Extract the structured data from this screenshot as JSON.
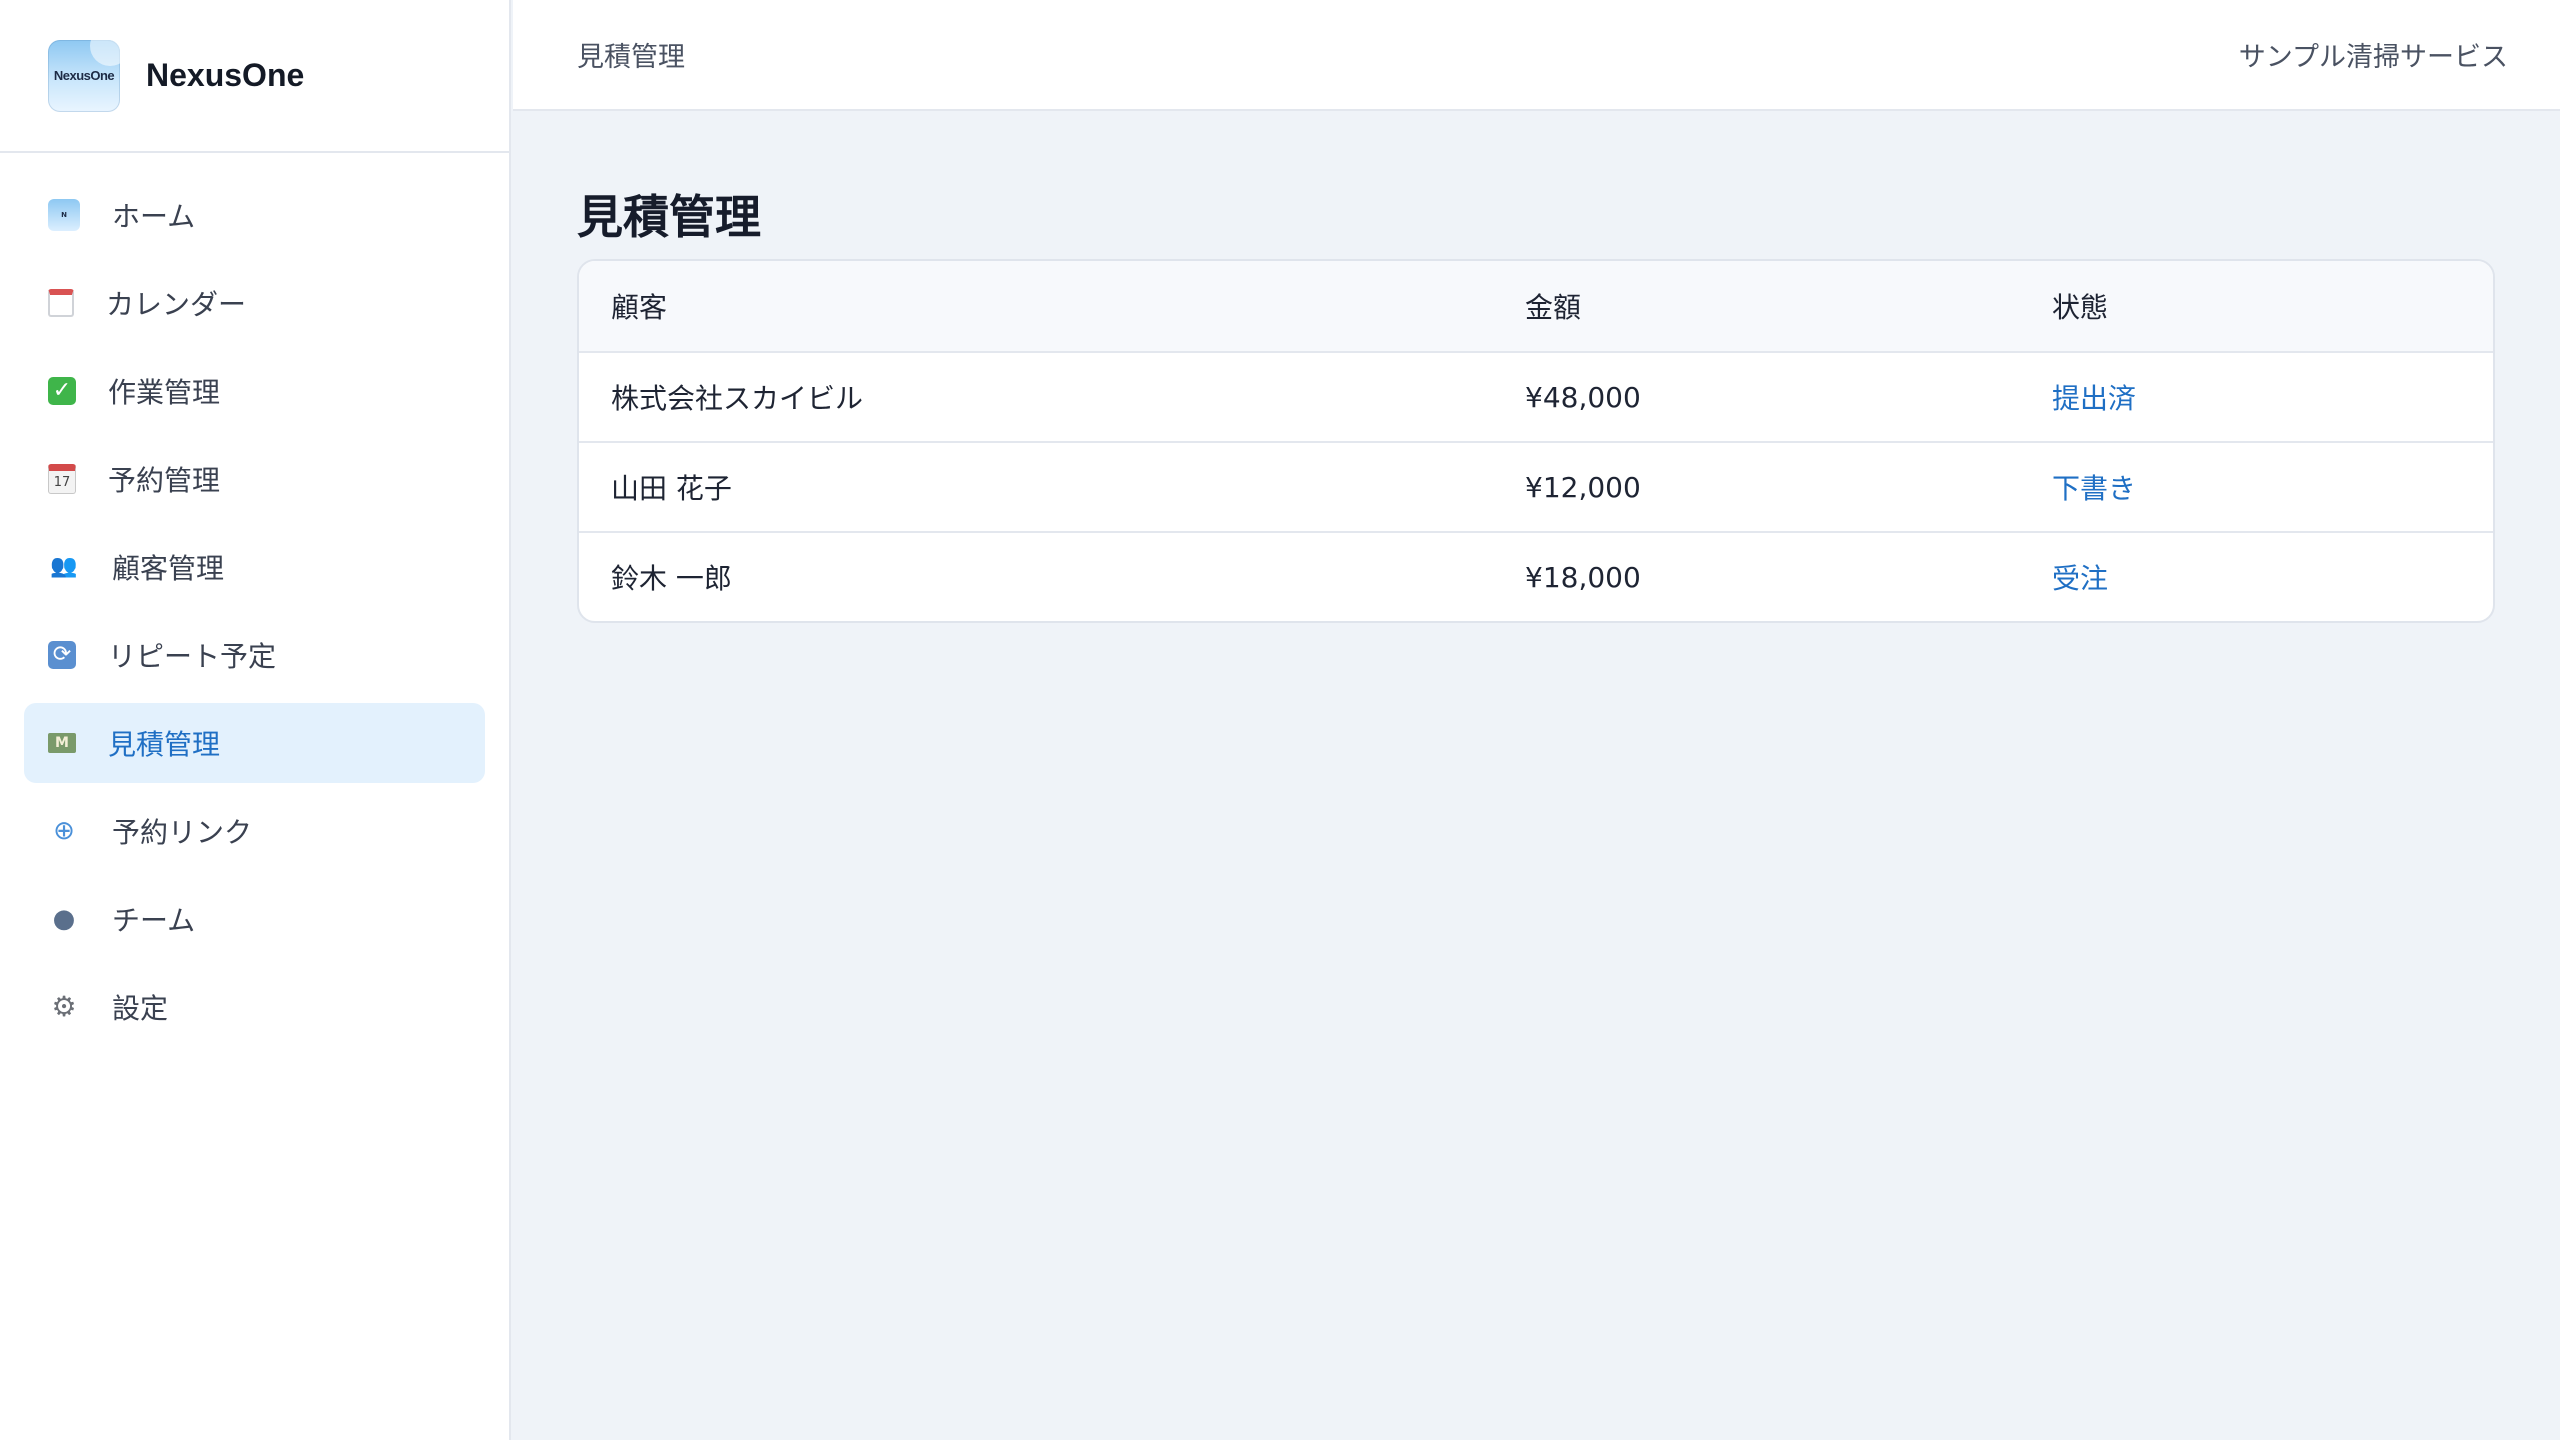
{
  "app": {
    "name": "NexusOne",
    "logo_text": "NexusOne"
  },
  "sidebar": {
    "items": [
      {
        "label": "ホーム",
        "icon": "home-logo-icon",
        "active": false
      },
      {
        "label": "カレンダー",
        "icon": "calendar-icon",
        "active": false
      },
      {
        "label": "作業管理",
        "icon": "check-box-icon",
        "active": false
      },
      {
        "label": "予約管理",
        "icon": "date-calendar-icon",
        "active": false
      },
      {
        "label": "顧客管理",
        "icon": "people-icon",
        "active": false
      },
      {
        "label": "リピート予定",
        "icon": "repeat-icon",
        "active": false
      },
      {
        "label": "見積管理",
        "icon": "money-icon",
        "active": true
      },
      {
        "label": "予約リンク",
        "icon": "globe-icon",
        "active": false
      },
      {
        "label": "チーム",
        "icon": "user-icon",
        "active": false
      },
      {
        "label": "設定",
        "icon": "gear-icon",
        "active": false
      }
    ]
  },
  "header": {
    "breadcrumb": "見積管理",
    "company": "サンプル清掃サービス"
  },
  "main": {
    "title": "見積管理",
    "table": {
      "columns": [
        "顧客",
        "金額",
        "状態"
      ],
      "rows": [
        {
          "customer": "株式会社スカイビル",
          "amount": "¥48,000",
          "status": "提出済"
        },
        {
          "customer": "山田 花子",
          "amount": "¥12,000",
          "status": "下書き"
        },
        {
          "customer": "鈴木 一郎",
          "amount": "¥18,000",
          "status": "受注"
        }
      ]
    }
  },
  "colors": {
    "accent": "#1f6fc4",
    "active_bg": "#e3f1fd",
    "page_bg": "#eff3f8"
  }
}
